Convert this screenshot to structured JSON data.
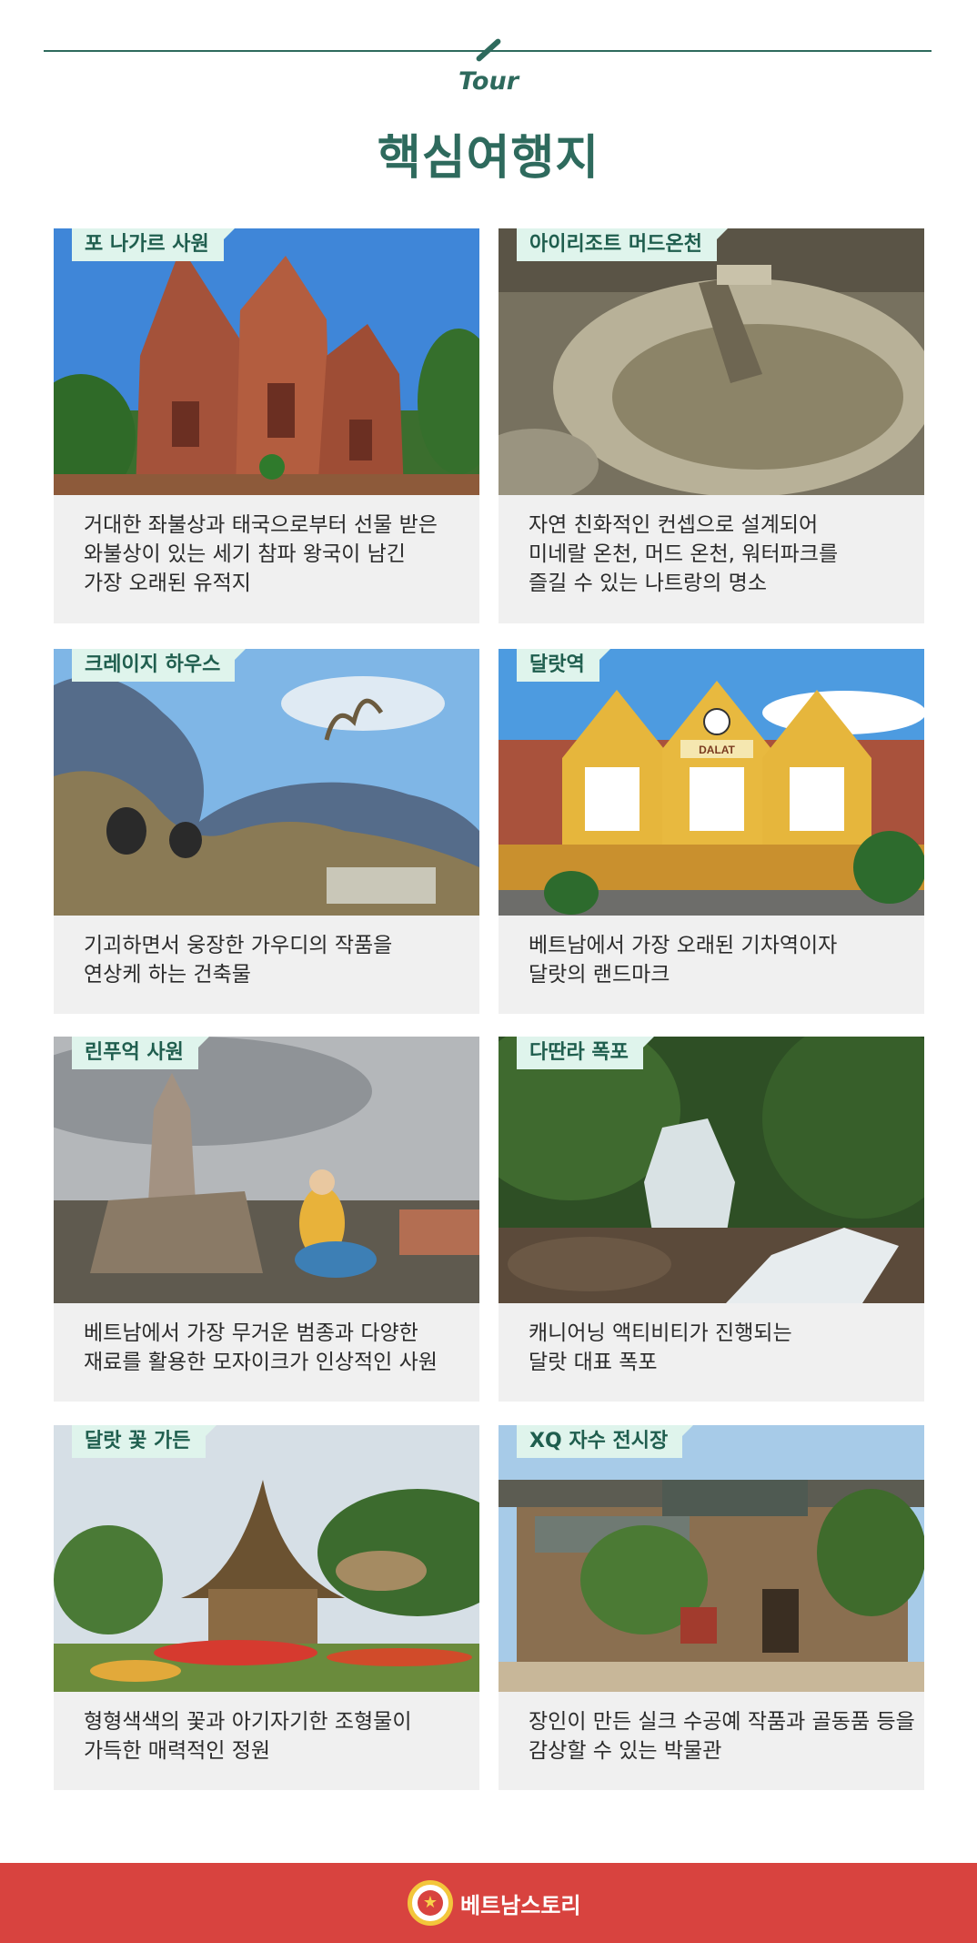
{
  "header": {
    "tour_label": "Tour",
    "title": "핵심여행지"
  },
  "cards": [
    {
      "name": "포 나가르 사원",
      "lines": [
        "거대한 좌불상과 태국으로부터 선물 받은",
        "와불상이 있는 세기 참파 왕국이 남긴",
        "가장 오래된 유적지"
      ]
    },
    {
      "name": "아이리조트 머드온천",
      "lines": [
        "자연 친화적인 컨셉으로 설계되어",
        "미네랄 온천, 머드 온천, 워터파크를",
        "즐길 수 있는 나트랑의 명소"
      ]
    },
    {
      "name": "크레이지 하우스",
      "lines": [
        "기괴하면서 웅장한 가우디의 작품을",
        "연상케 하는 건축물"
      ]
    },
    {
      "name": "달랏역",
      "sign": "DALAT",
      "lines": [
        "베트남에서 가장 오래된 기차역이자",
        "달랏의 랜드마크"
      ]
    },
    {
      "name": "린푸억 사원",
      "lines": [
        "베트남에서 가장 무거운 범종과 다양한",
        "재료를 활용한 모자이크가 인상적인 사원"
      ]
    },
    {
      "name": "다딴라 폭포",
      "lines": [
        "캐니어닝 액티비티가 진행되는",
        "달랏 대표 폭포"
      ]
    },
    {
      "name": "달랏 꽃 가든",
      "lines": [
        "형형색색의 꽃과 아기자기한 조형물이",
        "가득한 매력적인 정원"
      ]
    },
    {
      "name": "XQ 자수 전시장",
      "lines": [
        "장인이 만든 실크 수공예 작품과 골동품 등을",
        "감상할 수 있는 박물관"
      ]
    }
  ],
  "footer": {
    "brand": "베트남스토리",
    "logo_glyph": "★"
  },
  "colors": {
    "accent": "#2e6a5d",
    "tag_bg": "#dff4ec",
    "card_bg": "#f0f0f0",
    "footer_bg": "#d8433f"
  }
}
